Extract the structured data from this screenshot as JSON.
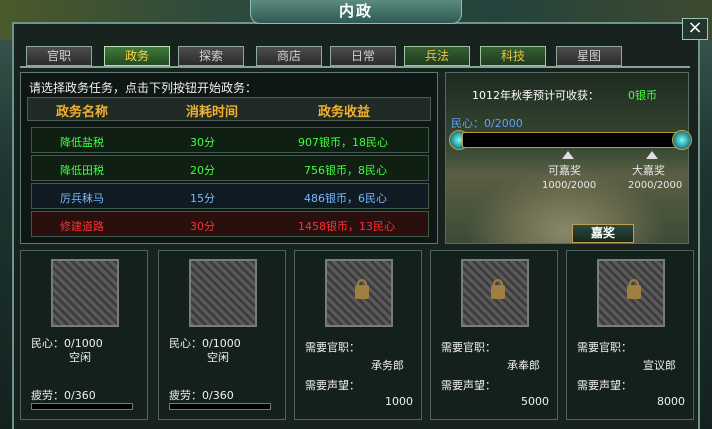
{
  "window": {
    "title": "内政",
    "close_label": "×"
  },
  "tabs": [
    {
      "label": "官职",
      "style": "normal"
    },
    {
      "label": "政务",
      "style": "active"
    },
    {
      "label": "探索",
      "style": "normal"
    },
    {
      "label": "商店",
      "style": "normal"
    },
    {
      "label": "日常",
      "style": "normal"
    },
    {
      "label": "兵法",
      "style": "highlight"
    },
    {
      "label": "科技",
      "style": "highlight"
    },
    {
      "label": "星图",
      "style": "normal"
    }
  ],
  "tasks": {
    "prompt": "请选择政务任务，点击下列按钮开始政务：",
    "headers": {
      "name": "政务名称",
      "time": "消耗时间",
      "reward": "政务收益"
    },
    "rows": [
      {
        "name": "降低盐税",
        "time": "30分",
        "reward": "907银币，18民心",
        "color": "#40ff40"
      },
      {
        "name": "降低田税",
        "time": "20分",
        "reward": "756银币，8民心",
        "color": "#40ff40"
      },
      {
        "name": "厉兵秣马",
        "time": "15分",
        "reward": "486银币，6民心",
        "color": "#7ab8ff"
      },
      {
        "name": "修建道路",
        "time": "30分",
        "reward": "1458银币，13民心",
        "color": "#ff3030"
      }
    ]
  },
  "harvest": {
    "label": "1012年秋季预计可收获：",
    "value": "0银币"
  },
  "morale": {
    "label": "民心：0/2000",
    "current": 0,
    "max": 2000,
    "milestones": [
      {
        "label": "可嘉奖",
        "value": "1000/2000"
      },
      {
        "label": "大嘉奖",
        "value": "2000/2000"
      }
    ],
    "reward_button": "嘉奖"
  },
  "slots": [
    {
      "locked": false,
      "morale": "民心：0/1000",
      "status": "空闲",
      "fatigue": "疲劳：0/360",
      "fatigue_value": 0
    },
    {
      "locked": false,
      "morale": "民心：0/1000",
      "status": "空闲",
      "fatigue": "疲劳：0/360",
      "fatigue_value": 0
    },
    {
      "locked": true,
      "rank_label": "需要官职：",
      "rank": "承务郎",
      "fame_label": "需要声望：",
      "fame": "1000"
    },
    {
      "locked": true,
      "rank_label": "需要官职：",
      "rank": "承奉郎",
      "fame_label": "需要声望：",
      "fame": "5000"
    },
    {
      "locked": true,
      "rank_label": "需要官职：",
      "rank": "宣议郎",
      "fame_label": "需要声望：",
      "fame": "8000"
    }
  ]
}
